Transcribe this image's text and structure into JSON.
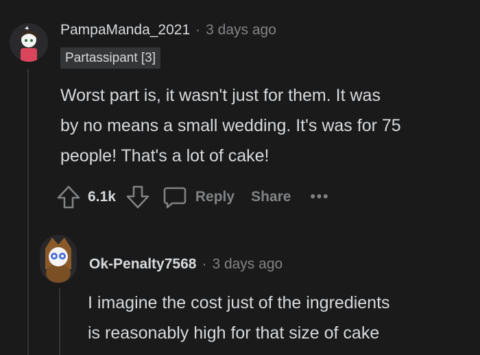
{
  "comment": {
    "username": "PampaManda_2021",
    "separator": "·",
    "time": "3 days ago",
    "flair": "Partassipant [3]",
    "body_lines": [
      "Worst part is, it wasn't just for them. It was",
      "by no means a small wedding. It's was for 75",
      "people! That's a lot of cake!"
    ],
    "votes": "6.1k",
    "reply_label": "Reply",
    "share_label": "Share",
    "more_label": "•••"
  },
  "reply": {
    "username": "Ok-Penalty7568",
    "separator": "·",
    "time": "3 days ago",
    "body_lines": [
      "I imagine the cost just of the ingredients",
      "is reasonably high for that size of cake"
    ]
  },
  "colors": {
    "background": "#1a1a1b",
    "text": "#d7dadc",
    "muted": "#818384",
    "flair_bg": "#343536"
  }
}
